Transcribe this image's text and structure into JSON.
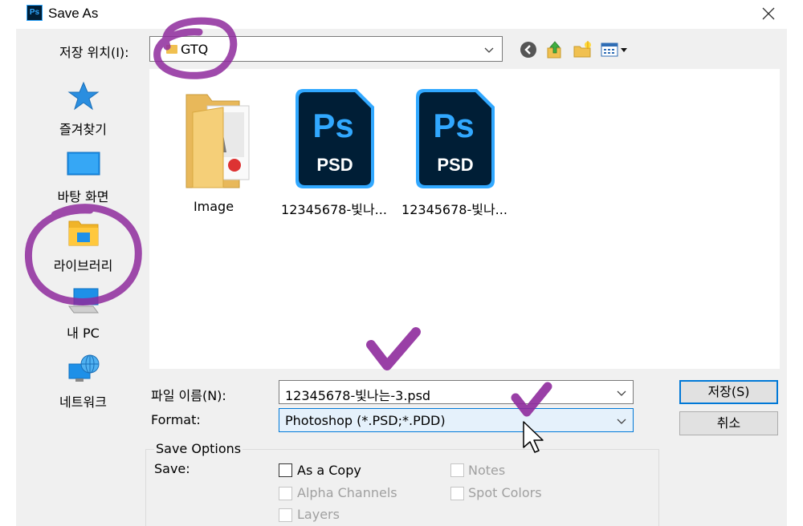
{
  "window": {
    "app_icon": "Ps",
    "title": "Save As"
  },
  "location": {
    "label": "저장 위치(I):",
    "value": "GTQ"
  },
  "toolbar_icons": [
    "back-icon",
    "up-folder-icon",
    "new-folder-icon",
    "view-menu-icon"
  ],
  "places": [
    {
      "label": "즐겨찾기",
      "icon": "star-icon"
    },
    {
      "label": "바탕 화면",
      "icon": "desktop-icon"
    },
    {
      "label": "라이브러리",
      "icon": "library-icon"
    },
    {
      "label": "내 PC",
      "icon": "pc-icon"
    },
    {
      "label": "네트워크",
      "icon": "network-icon"
    }
  ],
  "files": [
    {
      "name": "Image",
      "type": "folder"
    },
    {
      "name": "12345678-빛나...",
      "type": "psd",
      "badge_top": "Ps",
      "badge_bottom": "PSD"
    },
    {
      "name": "12345678-빛나...",
      "type": "psd",
      "badge_top": "Ps",
      "badge_bottom": "PSD"
    }
  ],
  "filename": {
    "label": "파일 이름(N):",
    "value": "12345678-빛나는-3.psd"
  },
  "format": {
    "label": "Format:",
    "value": "Photoshop (*.PSD;*.PDD)"
  },
  "buttons": {
    "save": "저장(S)",
    "cancel": "취소"
  },
  "save_options": {
    "title": "Save Options",
    "save_label": "Save:",
    "checkboxes": [
      {
        "label": "As a Copy",
        "checked": false,
        "enabled": true
      },
      {
        "label": "Notes",
        "checked": false,
        "enabled": false
      },
      {
        "label": "Alpha Channels",
        "checked": false,
        "enabled": false
      },
      {
        "label": "Spot Colors",
        "checked": false,
        "enabled": false
      },
      {
        "label": "Layers",
        "checked": false,
        "enabled": false
      }
    ]
  },
  "colors": {
    "annotation": "#8e2a9c",
    "ps_dark": "#001e36",
    "ps_blue": "#31a8ff",
    "accent": "#0078d7"
  }
}
